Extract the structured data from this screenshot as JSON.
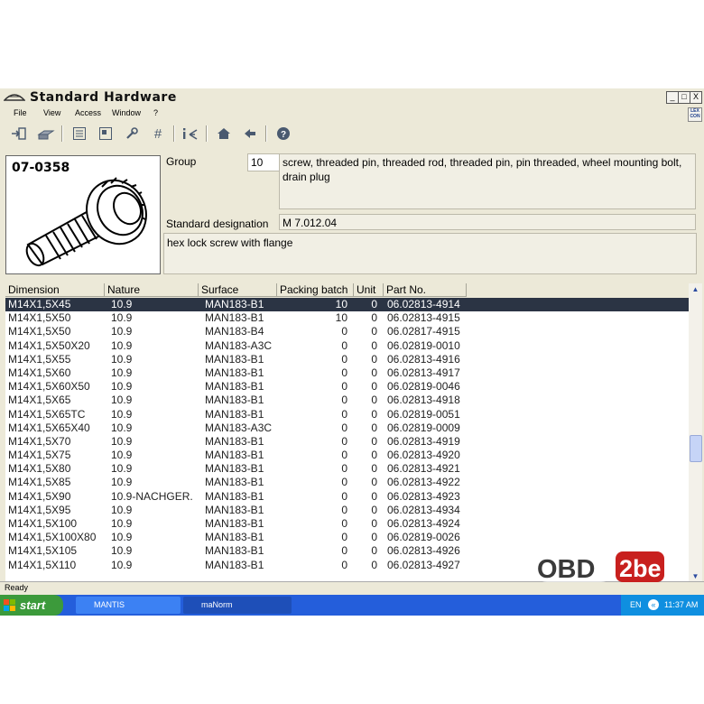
{
  "window": {
    "title": "Standard Hardware",
    "minimize": "_",
    "maximize": "□",
    "close": "X"
  },
  "menu": [
    {
      "label": "File"
    },
    {
      "label": "View"
    },
    {
      "label": "Access"
    },
    {
      "label": "Window"
    },
    {
      "label": "?"
    }
  ],
  "mdi_icon_text": "LEX\nCON",
  "part": {
    "number": "07-0358",
    "group_label": "Group",
    "group_code": "10",
    "group_description": "screw, threaded pin, threaded rod, threaded pin, pin threaded, wheel mounting bolt, drain plug",
    "std_label": "Standard designation",
    "std_value": "M 7.012.04",
    "description": "hex lock screw with flange"
  },
  "table": {
    "headers": [
      "Dimension",
      "Nature",
      "Surface",
      "Packing batch",
      "Unit",
      "Part No."
    ],
    "rows": [
      [
        "M14X1,5X45",
        "10.9",
        "MAN183-B1",
        "10",
        "0",
        "06.02813-4914"
      ],
      [
        "M14X1,5X50",
        "10.9",
        "MAN183-B1",
        "10",
        "0",
        "06.02813-4915"
      ],
      [
        "M14X1,5X50",
        "10.9",
        "MAN183-B4",
        "0",
        "0",
        "06.02817-4915"
      ],
      [
        "M14X1,5X50X20",
        "10.9",
        "MAN183-A3C",
        "0",
        "0",
        "06.02819-0010"
      ],
      [
        "M14X1,5X55",
        "10.9",
        "MAN183-B1",
        "0",
        "0",
        "06.02813-4916"
      ],
      [
        "M14X1,5X60",
        "10.9",
        "MAN183-B1",
        "0",
        "0",
        "06.02813-4917"
      ],
      [
        "M14X1,5X60X50",
        "10.9",
        "MAN183-B1",
        "0",
        "0",
        "06.02819-0046"
      ],
      [
        "M14X1,5X65",
        "10.9",
        "MAN183-B1",
        "0",
        "0",
        "06.02813-4918"
      ],
      [
        "M14X1,5X65TC",
        "10.9",
        "MAN183-B1",
        "0",
        "0",
        "06.02819-0051"
      ],
      [
        "M14X1,5X65X40",
        "10.9",
        "MAN183-A3C",
        "0",
        "0",
        "06.02819-0009"
      ],
      [
        "M14X1,5X70",
        "10.9",
        "MAN183-B1",
        "0",
        "0",
        "06.02813-4919"
      ],
      [
        "M14X1,5X75",
        "10.9",
        "MAN183-B1",
        "0",
        "0",
        "06.02813-4920"
      ],
      [
        "M14X1,5X80",
        "10.9",
        "MAN183-B1",
        "0",
        "0",
        "06.02813-4921"
      ],
      [
        "M14X1,5X85",
        "10.9",
        "MAN183-B1",
        "0",
        "0",
        "06.02813-4922"
      ],
      [
        "M14X1,5X90",
        "10.9-NACHGER.",
        "MAN183-B1",
        "0",
        "0",
        "06.02813-4923"
      ],
      [
        "M14X1,5X95",
        "10.9",
        "MAN183-B1",
        "0",
        "0",
        "06.02813-4934"
      ],
      [
        "M14X1,5X100",
        "10.9",
        "MAN183-B1",
        "0",
        "0",
        "06.02813-4924"
      ],
      [
        "M14X1,5X100X80",
        "10.9",
        "MAN183-B1",
        "0",
        "0",
        "06.02819-0026"
      ],
      [
        "M14X1,5X105",
        "10.9",
        "MAN183-B1",
        "0",
        "0",
        "06.02813-4926"
      ],
      [
        "M14X1,5X110",
        "10.9",
        "MAN183-B1",
        "0",
        "0",
        "06.02813-4927"
      ]
    ],
    "selected_index": 0
  },
  "status": "Ready",
  "taskbar": {
    "start": "start",
    "tasks": [
      "MANTIS",
      "maNorm"
    ],
    "lang": "EN",
    "time": "11:37 AM"
  },
  "watermark": {
    "part1": "OBD",
    "part2": "2be"
  },
  "colors": {
    "selected_row": "#2b3444",
    "taskbar": "#245edb",
    "start": "#3c9a3b"
  }
}
